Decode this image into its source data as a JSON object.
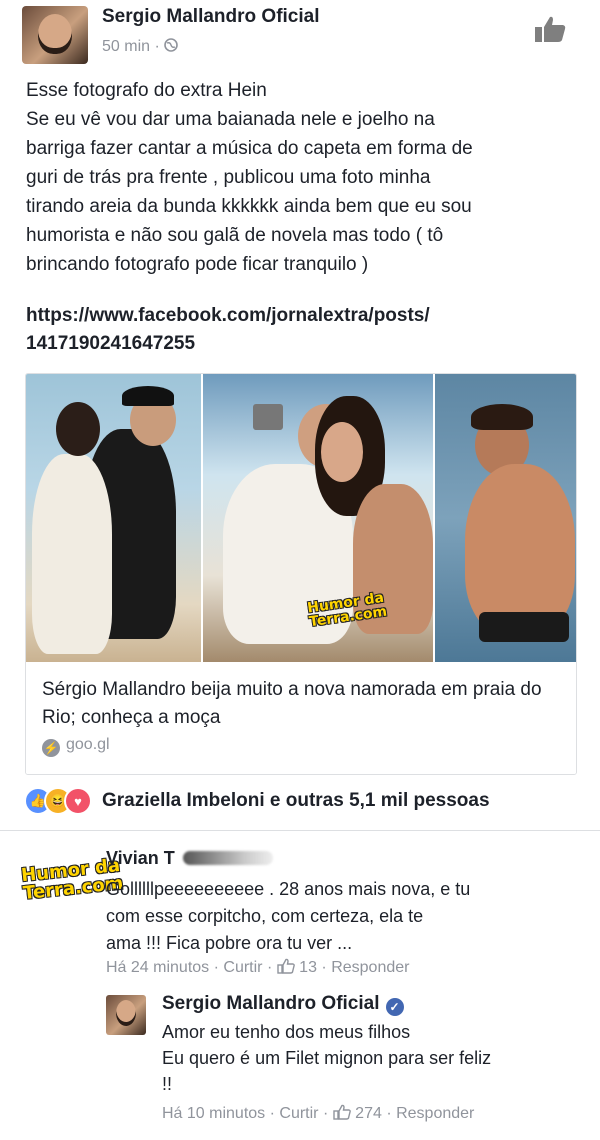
{
  "post": {
    "author": "Sergio Mallandro Oficial",
    "time": "50 min",
    "privacy_icon": "globe-icon",
    "text_lines": [
      "Esse fotografo do extra Hein",
      "Se eu vê vou dar uma baianada nele e joelho na",
      "barriga fazer cantar a música do capeta em forma de",
      "guri de trás pra frente , publicou uma foto minha",
      "tirando areia da bunda kkkkkk ainda bem que eu sou",
      "humorista e não sou galã de novela mas todo ( tô",
      "brincando fotografo pode ficar tranquilo )"
    ],
    "link_lines": [
      "https://www.facebook.com/jornalextra/posts/",
      "1417190241647255"
    ]
  },
  "card": {
    "watermark_line1": "Humor da",
    "watermark_line2": "Terra.com",
    "title": "Sérgio Mallandro beija muito a nova namorada em praia do Rio; conheça a moça",
    "domain": "goo.gl"
  },
  "reactions": {
    "text": "Graziella Imbeloni e outras 5,1 mil pessoas"
  },
  "comment": {
    "avatar_logo_line1": "Humor da",
    "avatar_logo_line2": "Terra.com",
    "author": "Vivian T",
    "text_lines": [
      "Gollllllpeeeeeeeeee . 28 anos mais nova, e tu",
      "com esse corpitcho, com certeza, ela te",
      "ama !!! Fica pobre ora tu ver ..."
    ],
    "time": "Há 24 minutos",
    "like": "Curtir",
    "likes": "13",
    "reply": "Responder"
  },
  "reply": {
    "author": "Sergio Mallandro Oficial",
    "text_lines": [
      "Amor eu tenho dos meus filhos",
      "Eu quero é um Filet mignon para ser feliz",
      "!!"
    ],
    "time": "Há 10 minutos",
    "like": "Curtir",
    "likes": "274",
    "reply": "Responder"
  },
  "colors": {
    "text": "#1d2129",
    "meta": "#90949c",
    "like_blue": "#5890ff",
    "love_red": "#f25268",
    "haha_yellow": "#f7b125",
    "verified": "#4267b2"
  }
}
